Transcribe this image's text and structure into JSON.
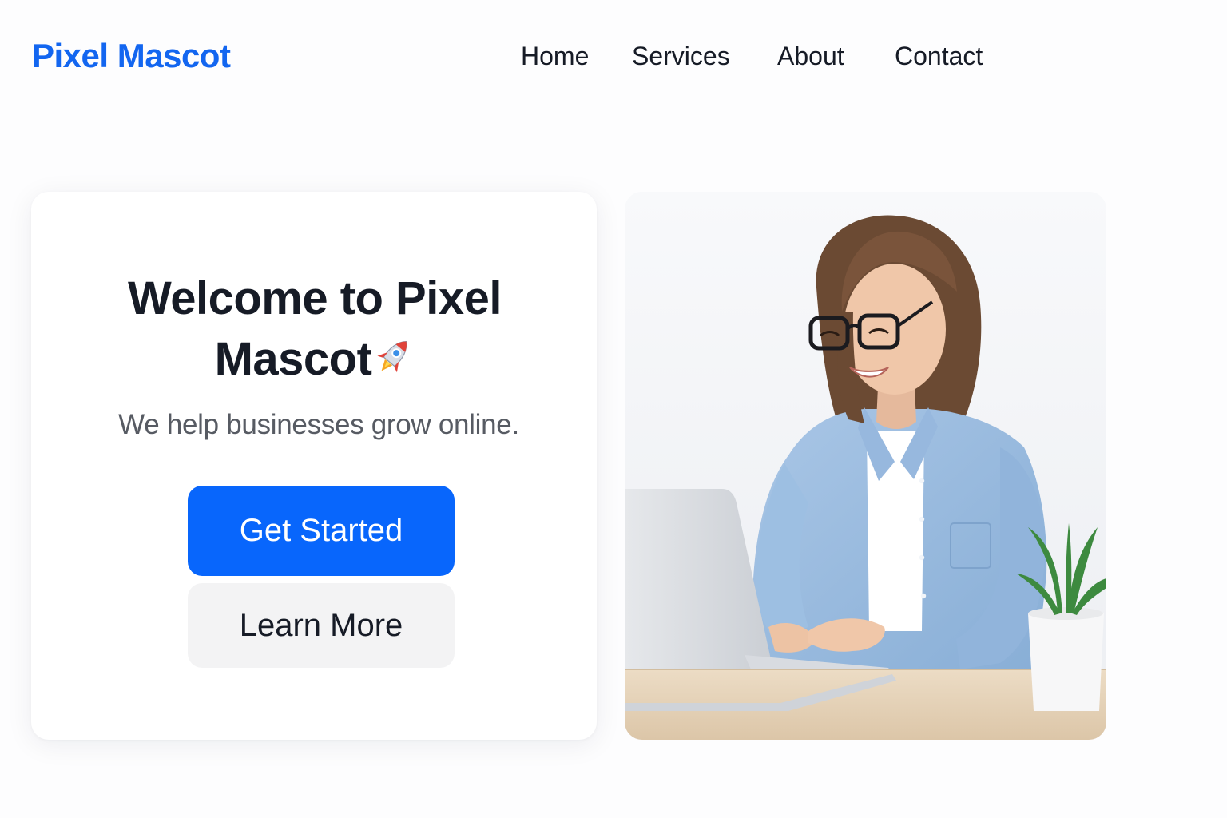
{
  "header": {
    "brand": "Pixel Mascot",
    "nav": [
      {
        "label": "Home"
      },
      {
        "label": "Services"
      },
      {
        "label": "About"
      },
      {
        "label": "Contact"
      }
    ]
  },
  "hero": {
    "title_line1": "Welcome to Pixel",
    "title_line2": "Mascot",
    "title_icon": "rocket-icon",
    "subtitle": "We help businesses grow online.",
    "primary_button": "Get Started",
    "secondary_button": "Learn More"
  },
  "colors": {
    "brand": "#1366f0",
    "primary_button": "#0866fc",
    "secondary_button": "#f3f3f4",
    "heading": "#161b26",
    "subtitle": "#575b63"
  },
  "image": {
    "subject": "hero-photo-woman-at-laptop"
  }
}
